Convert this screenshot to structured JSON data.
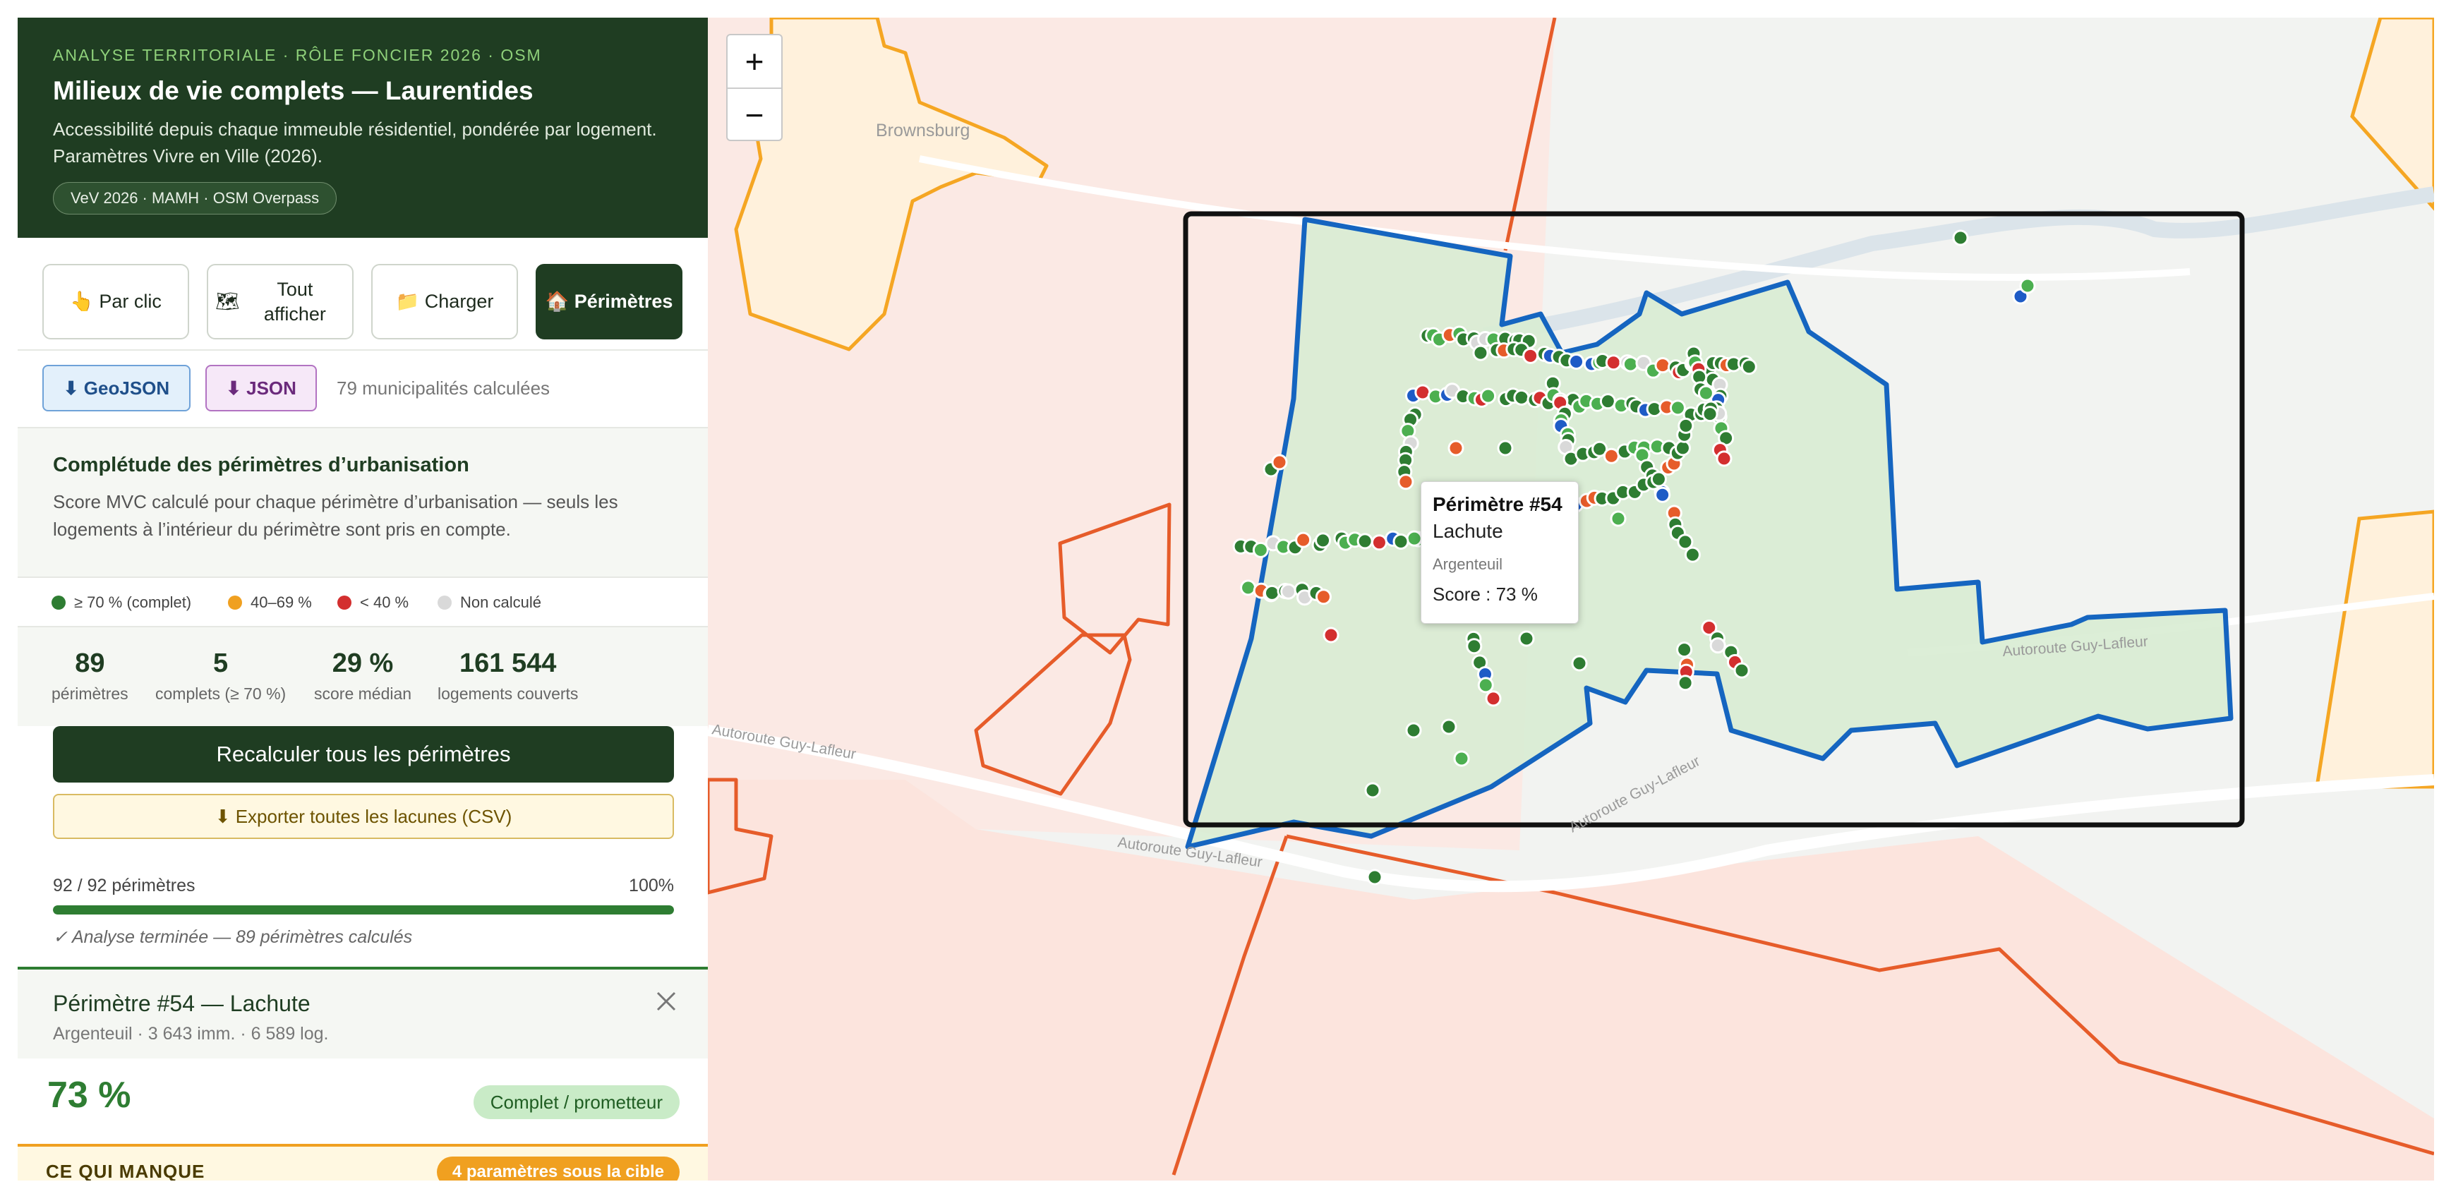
{
  "header": {
    "kicker": "ANALYSE TERRITORIALE · RÔLE FONCIER 2026 · OSM",
    "title": "Milieux de vie complets — Laurentides",
    "subtitle": "Accessibilité depuis chaque immeuble résidentiel, pondérée par logement. Paramètres Vivre en Ville (2026).",
    "source_pill": "VeV 2026 · MAMH · OSM Overpass"
  },
  "modes": [
    {
      "icon": "👆",
      "label": "Par clic",
      "active": false
    },
    {
      "icon": "🗺",
      "label": "Tout afficher",
      "active": false
    },
    {
      "icon": "📁",
      "label": "Charger",
      "active": false
    },
    {
      "icon": "🏠",
      "label": "Périmètres",
      "active": true
    }
  ],
  "downloads": {
    "geojson_label": "⬇ GeoJSON",
    "json_label": "⬇ JSON",
    "count_text": "79 municipalités calculées"
  },
  "description": {
    "heading": "Complétude des périmètres d’urbanisation",
    "text": "Score MVC calculé pour chaque périmètre d’urbanisation — seuls les logements à l’intérieur du périmètre sont pris en compte."
  },
  "legend": [
    {
      "label": "≥ 70 % (complet)",
      "color": "#2e7d32"
    },
    {
      "label": "40–69 %",
      "color": "#f0a020"
    },
    {
      "label": "< 40 %",
      "color": "#d32f2f"
    },
    {
      "label": "Non calculé",
      "color": "#d9d9d9"
    }
  ],
  "stats": [
    {
      "value": "89",
      "label": "périmètres"
    },
    {
      "value": "5",
      "label": "complets (≥ 70 %)"
    },
    {
      "value": "29 %",
      "label": "score médian"
    },
    {
      "value": "161 544",
      "label": "logements couverts"
    }
  ],
  "actions": {
    "recalc_label": "Recalculer tous les périmètres",
    "export_label": "⬇ Exporter toutes les lacunes (CSV)"
  },
  "progress": {
    "count_label": "92 / 92 périmètres",
    "percent_label": "100%",
    "fraction": 1.0,
    "status": "✓ Analyse terminée — 89 périmètres calculés"
  },
  "detail": {
    "title": "Périmètre #54 — Lachute",
    "meta": "Argenteuil · 3 643 imm. · 6 589 log.",
    "score": "73 %",
    "badge": "Complet / prometteur"
  },
  "missing": {
    "heading": "CE QUI MANQUE",
    "badge": "4 paramètres sous la cible"
  },
  "map": {
    "zoom_in": "+",
    "zoom_out": "−",
    "place_labels": {
      "brownsburg": "Brownsburg",
      "road_1": "Autoroute Guy-Lafleur",
      "road_2": "Autoroute Guy-Lafleur",
      "road_3": "Autoroute Guy-Lafleur",
      "road_4": "Autoroute Guy-Lafleur"
    },
    "tooltip": {
      "title": "Périmètre #54",
      "name": "Lachute",
      "region": "Argenteuil",
      "score": "Score : 73 %"
    },
    "colors": {
      "perimeter_stroke": "#1565c0",
      "perimeter_fill": "#d8ecd3",
      "selection_frame": "#111111",
      "muni_orange": "#e65c2a",
      "muni_yellow": "#f5a623"
    }
  }
}
